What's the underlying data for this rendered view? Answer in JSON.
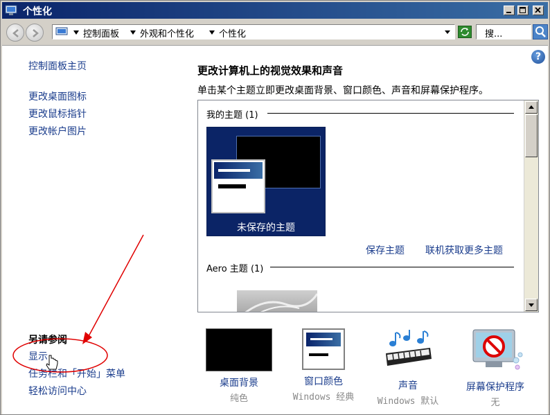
{
  "window": {
    "title": "个性化"
  },
  "address_bar": {
    "breadcrumbs": [
      "控制面板",
      "外观和个性化",
      "个性化"
    ],
    "search_placeholder": "搜..."
  },
  "left_pane": {
    "home_link": "控制面板主页",
    "links": [
      "更改桌面图标",
      "更改鼠标指针",
      "更改帐户图片"
    ],
    "see_also_title": "另请参阅",
    "see_also_links": [
      "显示",
      "任务栏和「开始」菜单",
      "轻松访问中心"
    ]
  },
  "main": {
    "heading": "更改计算机上的视觉效果和声音",
    "description": "单击某个主题立即更改桌面背景、窗口颜色、声音和屏幕保护程序。",
    "groups": {
      "my_themes": "我的主题 (1)",
      "aero_themes": "Aero 主题 (1)"
    },
    "unsaved_theme_label": "未保存的主题",
    "save_theme": "保存主题",
    "more_themes": "联机获取更多主题"
  },
  "bottom_items": {
    "background": {
      "label": "桌面背景",
      "sub": "纯色"
    },
    "window_color": {
      "label": "窗口颜色",
      "sub": "Windows 经典"
    },
    "sound": {
      "label": "声音",
      "sub": "Windows 默认"
    },
    "screensaver": {
      "label": "屏幕保护程序",
      "sub": "无"
    }
  },
  "colors": {
    "link": "#1a3c8c",
    "titlebar_start": "#0a246a",
    "titlebar_end": "#3a6ea5",
    "annotation": "#e00000"
  },
  "icons": {
    "help": "?"
  }
}
